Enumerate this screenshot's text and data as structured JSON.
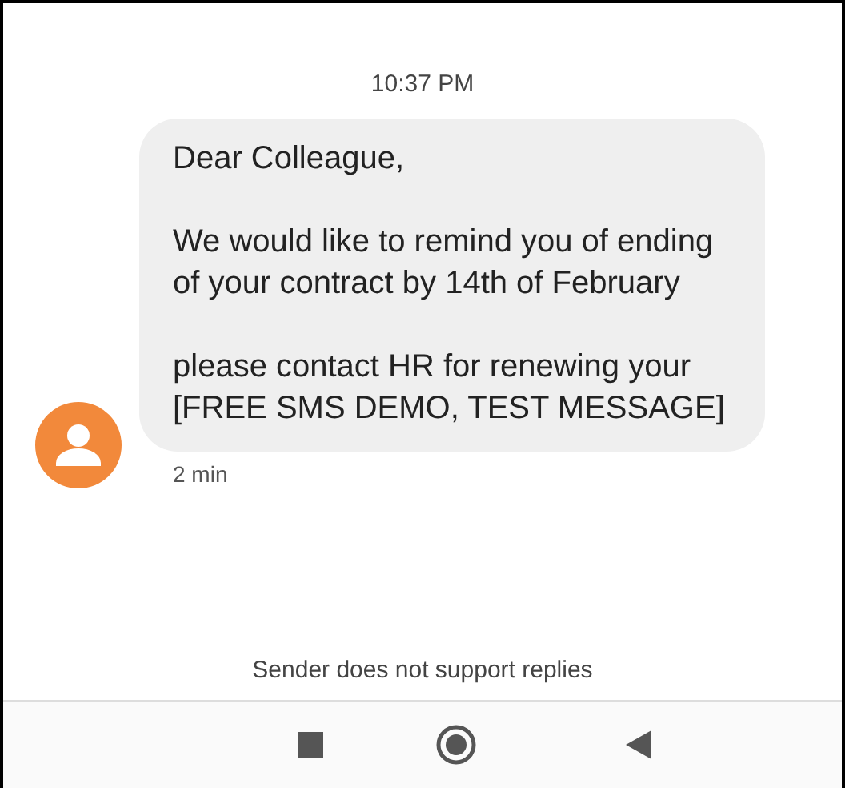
{
  "timestamp": "10:37 PM",
  "message": {
    "paragraphs": [
      "Dear Colleague,",
      "We would like to remind you of ending of your contract by 14th of February",
      "please contact HR for renewing your [FREE SMS DEMO, TEST MESSAGE]"
    ],
    "age": "2 min"
  },
  "notice": "Sender does not support replies"
}
